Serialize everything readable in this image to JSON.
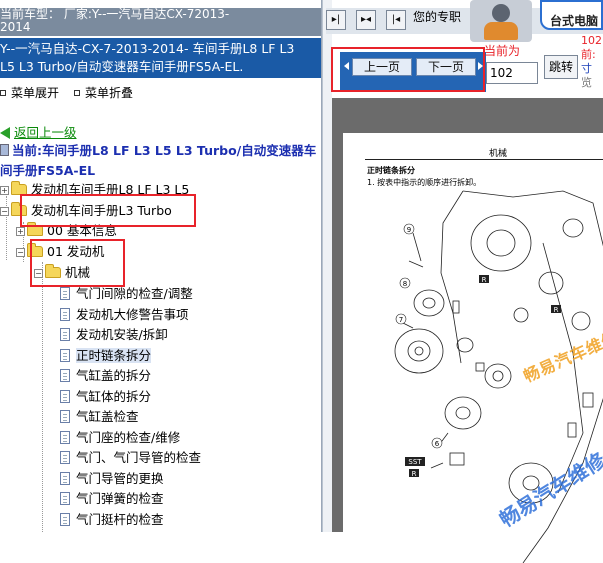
{
  "top_line": {
    "line1": "当前车型：  厂家:Y--一汽马自达CX-72013-",
    "line2": "2014"
  },
  "title": {
    "line1": "Y--一汽马自达-CX-7-2013-2014- 车间手册L8 LF L3",
    "line2": "L5 L3 Turbo/自动变速器车间手册FS5A-EL."
  },
  "menu": {
    "expand": "菜单展开",
    "collapse": "菜单折叠"
  },
  "back_link": "返回上一级",
  "current_path": {
    "line1": "当前:车间手册L8 LF L3 L5 L3 Turbo/自动变速器车",
    "line2": "间手册FS5A-EL"
  },
  "tree": [
    {
      "label": "发动机车间手册L8 LF L3 L5"
    },
    {
      "label": "发动机车间手册L3 Turbo"
    },
    {
      "label": "00 基本信息"
    },
    {
      "label": "01 发动机"
    },
    {
      "label": "机械"
    }
  ],
  "docs": [
    "气门间隙的检查/调整",
    "发动机大修警告事项",
    "发动机安装/拆卸",
    "正时链条拆分",
    "气缸盖的拆分",
    "气缸体的拆分",
    "气缸盖检查",
    "气门座的检查/维修",
    "气门、气门导管的检查",
    "气门导管的更换",
    "气门弹簧的检查",
    "气门挺杆的检查"
  ],
  "selected_doc_index": 3,
  "controls": {
    "promo_text": "您的专职",
    "ad_text": "台式电脑",
    "prev_label": "上一页",
    "next_label": "下一页",
    "current_label": "当前为",
    "page_value": "102",
    "jump_label": "跳转",
    "right_info": [
      "102",
      "前:",
      "寸",
      "览"
    ]
  },
  "document": {
    "section": "机械",
    "heading": "正时链条拆分",
    "step": "1. 按表中指示的顺序进行拆卸。",
    "watermark1": "畅易汽车维修",
    "watermark2": "畅易汽车维修",
    "callouts": [
      "9",
      "R",
      "8",
      "R",
      "7",
      "6",
      "SST",
      "R"
    ]
  },
  "colors": {
    "title_bg": "#1a5aa6",
    "highlight_red": "#e8232a",
    "link_green": "#0a8a0a",
    "path_blue": "#1c2fb0"
  }
}
